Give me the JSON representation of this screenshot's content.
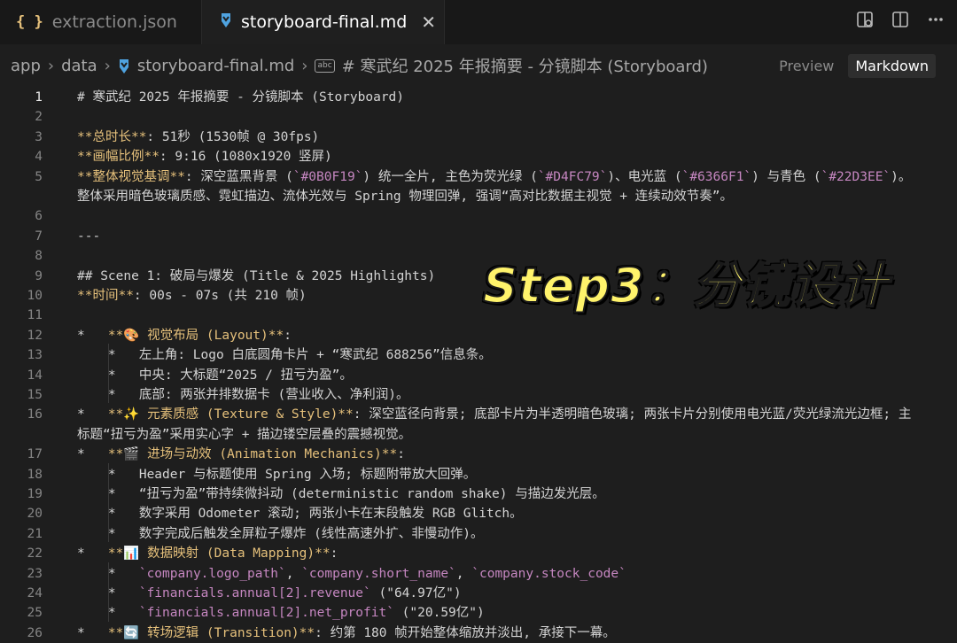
{
  "tabs": {
    "inactive": {
      "icon": "{ }",
      "label": "extraction.json"
    },
    "active": {
      "icon": "markdown-icon",
      "label": "storyboard-final.md"
    }
  },
  "breadcrumb": {
    "items": [
      "app",
      "data",
      "storyboard-final.md"
    ],
    "abc_label": "abc",
    "heading": "# 寒武纪 2025 年报摘要 - 分镜脚本 (Storyboard)"
  },
  "view_toggle": {
    "preview": "Preview",
    "markdown": "Markdown"
  },
  "overlay": {
    "text": "Step3：分镜设计",
    "color": "#fff36b"
  },
  "editor": {
    "current_line": 1,
    "lines": [
      {
        "n": "1",
        "t": "# 寒武纪 2025 年报摘要 - 分镜脚本 (Storyboard)"
      },
      {
        "n": "2",
        "t": ""
      },
      {
        "n": "3",
        "t": "**总时长**: 51秒 (1530帧 @ 30fps)"
      },
      {
        "n": "4",
        "t": "**画幅比例**: 9:16 (1080x1920 竖屏)"
      },
      {
        "n": "5",
        "t": "**整体视觉基调**: 深空蓝黑背景 (`#0B0F19`) 统一全片, 主色为荧光绿 (`#D4FC79`)、电光蓝 (`#6366F1`) 与青色 (`#22D3EE`)。"
      },
      {
        "n": "",
        "t": "整体采用暗色玻璃质感、霓虹描边、流体光效与 Spring 物理回弹, 强调“高对比数据主视觉 + 连续动效节奏”。"
      },
      {
        "n": "6",
        "t": ""
      },
      {
        "n": "7",
        "t": "---"
      },
      {
        "n": "8",
        "t": ""
      },
      {
        "n": "9",
        "t": "## Scene 1: 破局与爆发 (Title & 2025 Highlights)"
      },
      {
        "n": "10",
        "t": "**时间**: 00s - 07s (共 210 帧)"
      },
      {
        "n": "11",
        "t": ""
      },
      {
        "n": "12",
        "t": "*   **🎨 视觉布局 (Layout)**:"
      },
      {
        "n": "13",
        "t": "    *   左上角: Logo 白底圆角卡片 + “寒武纪 688256”信息条。"
      },
      {
        "n": "14",
        "t": "    *   中央: 大标题“2025 / 扭亏为盈”。"
      },
      {
        "n": "15",
        "t": "    *   底部: 两张并排数据卡 (营业收入、净利润)。"
      },
      {
        "n": "16",
        "t": "*   **✨ 元素质感 (Texture & Style)**: 深空蓝径向背景; 底部卡片为半透明暗色玻璃; 两张卡片分别使用电光蓝/荧光绿流光边框; 主"
      },
      {
        "n": "",
        "t": "标题“扭亏为盈”采用实心字 + 描边镂空层叠的震撼视觉。"
      },
      {
        "n": "17",
        "t": "*   **🎬 进场与动效 (Animation Mechanics)**:"
      },
      {
        "n": "18",
        "t": "    *   Header 与标题使用 Spring 入场; 标题附带放大回弹。"
      },
      {
        "n": "19",
        "t": "    *   “扭亏为盈”带持续微抖动 (deterministic random shake) 与描边发光层。"
      },
      {
        "n": "20",
        "t": "    *   数字采用 Odometer 滚动; 两张小卡在末段触发 RGB Glitch。"
      },
      {
        "n": "21",
        "t": "    *   数字完成后触发全屏粒子爆炸 (线性高速外扩、非慢动作)。"
      },
      {
        "n": "22",
        "t": "*   **📊 数据映射 (Data Mapping)**:"
      },
      {
        "n": "23",
        "t": "    *   `company.logo_path`, `company.short_name`, `company.stock_code`"
      },
      {
        "n": "24",
        "t": "    *   `financials.annual[2].revenue` (\"64.97亿\")"
      },
      {
        "n": "25",
        "t": "    *   `financials.annual[2].net_profit` (\"20.59亿\")"
      },
      {
        "n": "26",
        "t": "*   **🔄 转场逻辑 (Transition)**: 约第 180 帧开始整体缩放并淡出, 承接下一幕。"
      }
    ]
  }
}
